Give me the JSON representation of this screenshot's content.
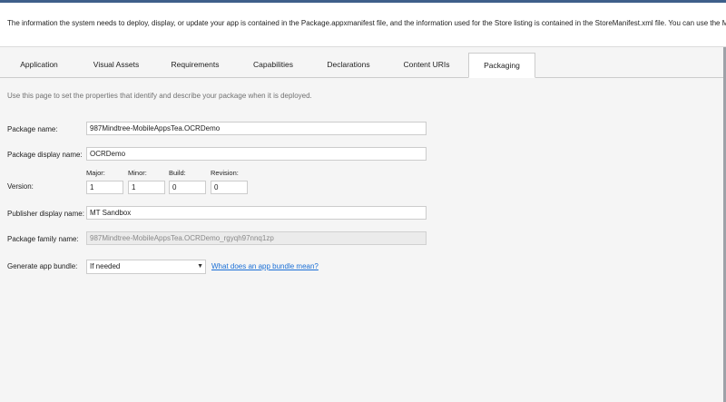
{
  "info_text": "The information the system needs to deploy, display, or update your app is contained in the Package.appxmanifest file, and the information used for the Store listing is contained in the StoreManifest.xml file. You can use the Manife",
  "tabs": [
    {
      "label": "Application",
      "active": false
    },
    {
      "label": "Visual Assets",
      "active": false
    },
    {
      "label": "Requirements",
      "active": false
    },
    {
      "label": "Capabilities",
      "active": false
    },
    {
      "label": "Declarations",
      "active": false
    },
    {
      "label": "Content URIs",
      "active": false
    },
    {
      "label": "Packaging",
      "active": true
    }
  ],
  "hint": "Use this page to set the properties that identify and describe your package when it is deployed.",
  "package_name": {
    "label": "Package name:",
    "value": "987Mindtree-MobileAppsTea.OCRDemo"
  },
  "package_display_name": {
    "label": "Package display name:",
    "value": "OCRDemo"
  },
  "version": {
    "label": "Version:",
    "major": {
      "label": "Major:",
      "value": "1"
    },
    "minor": {
      "label": "Minor:",
      "value": "1"
    },
    "build": {
      "label": "Build:",
      "value": "0"
    },
    "revision": {
      "label": "Revision:",
      "value": "0"
    }
  },
  "publisher_display_name": {
    "label": "Publisher display name:",
    "value": "MT Sandbox"
  },
  "package_family_name": {
    "label": "Package family name:",
    "value": "987Mindtree-MobileAppsTea.OCRDemo_rgyqh97nnq1zp"
  },
  "app_bundle": {
    "label": "Generate app bundle:",
    "value": "If needed",
    "link": "What does an app bundle mean?"
  }
}
